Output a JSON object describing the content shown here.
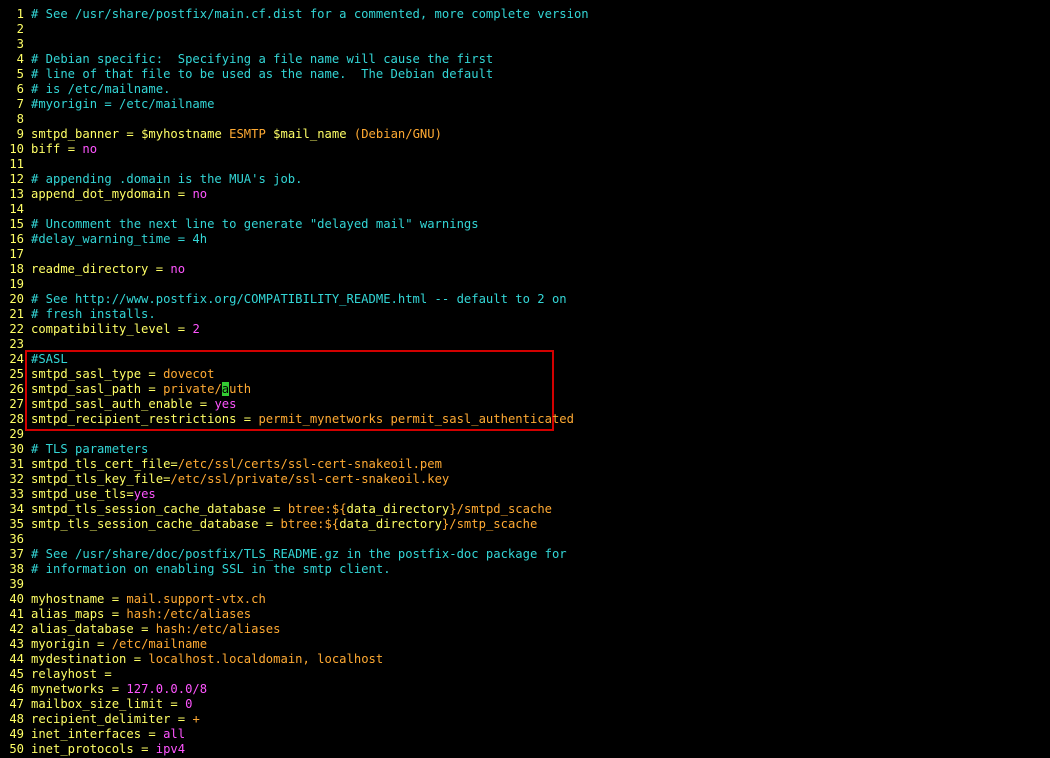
{
  "lines": [
    {
      "n": "1",
      "tokens": [
        {
          "t": "# See /usr/share/postfix/main.cf.dist for a commented, more complete version",
          "c": "comment"
        }
      ]
    },
    {
      "n": "2",
      "tokens": []
    },
    {
      "n": "3",
      "tokens": []
    },
    {
      "n": "4",
      "tokens": [
        {
          "t": "# Debian specific:  Specifying a file name will cause the first",
          "c": "comment"
        }
      ]
    },
    {
      "n": "5",
      "tokens": [
        {
          "t": "# line of that file to be used as the name.  The Debian default",
          "c": "comment"
        }
      ]
    },
    {
      "n": "6",
      "tokens": [
        {
          "t": "# is /etc/mailname.",
          "c": "comment"
        }
      ]
    },
    {
      "n": "7",
      "tokens": [
        {
          "t": "#myorigin = /etc/mailname",
          "c": "comment"
        }
      ]
    },
    {
      "n": "8",
      "tokens": []
    },
    {
      "n": "9",
      "tokens": [
        {
          "t": "smtpd_banner",
          "c": "key"
        },
        {
          "t": " = ",
          "c": "op"
        },
        {
          "t": "$myhostname",
          "c": "var"
        },
        {
          "t": " ESMTP ",
          "c": "val"
        },
        {
          "t": "$mail_name",
          "c": "var"
        },
        {
          "t": " (Debian/GNU)",
          "c": "val"
        }
      ]
    },
    {
      "n": "10",
      "tokens": [
        {
          "t": "biff",
          "c": "key"
        },
        {
          "t": " = ",
          "c": "op"
        },
        {
          "t": "no",
          "c": "const"
        }
      ]
    },
    {
      "n": "11",
      "tokens": []
    },
    {
      "n": "12",
      "tokens": [
        {
          "t": "# appending .domain is the MUA's job.",
          "c": "comment"
        }
      ]
    },
    {
      "n": "13",
      "tokens": [
        {
          "t": "append_dot_mydomain",
          "c": "key"
        },
        {
          "t": " = ",
          "c": "op"
        },
        {
          "t": "no",
          "c": "const"
        }
      ]
    },
    {
      "n": "14",
      "tokens": []
    },
    {
      "n": "15",
      "tokens": [
        {
          "t": "# Uncomment the next line to generate \"delayed mail\" warnings",
          "c": "comment"
        }
      ]
    },
    {
      "n": "16",
      "tokens": [
        {
          "t": "#delay_warning_time = 4h",
          "c": "comment"
        }
      ]
    },
    {
      "n": "17",
      "tokens": []
    },
    {
      "n": "18",
      "tokens": [
        {
          "t": "readme_directory",
          "c": "key"
        },
        {
          "t": " = ",
          "c": "op"
        },
        {
          "t": "no",
          "c": "const"
        }
      ]
    },
    {
      "n": "19",
      "tokens": []
    },
    {
      "n": "20",
      "tokens": [
        {
          "t": "# See http://www.postfix.org/COMPATIBILITY_README.html -- default to 2 on",
          "c": "comment"
        }
      ]
    },
    {
      "n": "21",
      "tokens": [
        {
          "t": "# fresh installs.",
          "c": "comment"
        }
      ]
    },
    {
      "n": "22",
      "tokens": [
        {
          "t": "compatibility_level",
          "c": "key"
        },
        {
          "t": " = ",
          "c": "op"
        },
        {
          "t": "2",
          "c": "const"
        }
      ]
    },
    {
      "n": "23",
      "tokens": []
    },
    {
      "n": "24",
      "tokens": [
        {
          "t": "#SASL",
          "c": "comment"
        }
      ]
    },
    {
      "n": "25",
      "tokens": [
        {
          "t": "smtpd_sasl_type",
          "c": "key"
        },
        {
          "t": " = ",
          "c": "op"
        },
        {
          "t": "dovecot",
          "c": "val"
        }
      ]
    },
    {
      "n": "26",
      "tokens": [
        {
          "t": "smtpd_sasl_path",
          "c": "key"
        },
        {
          "t": " = ",
          "c": "op"
        },
        {
          "t": "private/",
          "c": "val"
        },
        {
          "t": "a",
          "c": "cursor"
        },
        {
          "t": "uth",
          "c": "val"
        }
      ]
    },
    {
      "n": "27",
      "tokens": [
        {
          "t": "smtpd_sasl_auth_enable",
          "c": "key"
        },
        {
          "t": " = ",
          "c": "op"
        },
        {
          "t": "yes",
          "c": "const"
        }
      ]
    },
    {
      "n": "28",
      "tokens": [
        {
          "t": "smtpd_recipient_restrictions",
          "c": "key"
        },
        {
          "t": " = ",
          "c": "op"
        },
        {
          "t": "permit_mynetworks permit_sasl_authenticated",
          "c": "val"
        }
      ]
    },
    {
      "n": "29",
      "tokens": []
    },
    {
      "n": "30",
      "tokens": [
        {
          "t": "# TLS parameters",
          "c": "comment"
        }
      ]
    },
    {
      "n": "31",
      "tokens": [
        {
          "t": "smtpd_tls_cert_file",
          "c": "key"
        },
        {
          "t": "=",
          "c": "op"
        },
        {
          "t": "/etc/ssl/certs/ssl-cert-snakeoil.pem",
          "c": "val"
        }
      ]
    },
    {
      "n": "32",
      "tokens": [
        {
          "t": "smtpd_tls_key_file",
          "c": "key"
        },
        {
          "t": "=",
          "c": "op"
        },
        {
          "t": "/etc/ssl/private/ssl-cert-snakeoil.key",
          "c": "val"
        }
      ]
    },
    {
      "n": "33",
      "tokens": [
        {
          "t": "smtpd_use_tls",
          "c": "key"
        },
        {
          "t": "=",
          "c": "op"
        },
        {
          "t": "yes",
          "c": "const"
        }
      ]
    },
    {
      "n": "34",
      "tokens": [
        {
          "t": "smtpd_tls_session_cache_database",
          "c": "key"
        },
        {
          "t": " = ",
          "c": "op"
        },
        {
          "t": "btree:${",
          "c": "val"
        },
        {
          "t": "data_directory",
          "c": "var"
        },
        {
          "t": "}/smtpd_scache",
          "c": "val"
        }
      ]
    },
    {
      "n": "35",
      "tokens": [
        {
          "t": "smtp_tls_session_cache_database",
          "c": "key"
        },
        {
          "t": " = ",
          "c": "op"
        },
        {
          "t": "btree:${",
          "c": "val"
        },
        {
          "t": "data_directory",
          "c": "var"
        },
        {
          "t": "}/smtp_scache",
          "c": "val"
        }
      ]
    },
    {
      "n": "36",
      "tokens": []
    },
    {
      "n": "37",
      "tokens": [
        {
          "t": "# See /usr/share/doc/postfix/TLS_README.gz in the postfix-doc package for",
          "c": "comment"
        }
      ]
    },
    {
      "n": "38",
      "tokens": [
        {
          "t": "# information on enabling SSL in the smtp client.",
          "c": "comment"
        }
      ]
    },
    {
      "n": "39",
      "tokens": []
    },
    {
      "n": "40",
      "tokens": [
        {
          "t": "myhostname",
          "c": "key"
        },
        {
          "t": " = ",
          "c": "op"
        },
        {
          "t": "mail.support-vtx.ch",
          "c": "val"
        }
      ]
    },
    {
      "n": "41",
      "tokens": [
        {
          "t": "alias_maps",
          "c": "key"
        },
        {
          "t": " = ",
          "c": "op"
        },
        {
          "t": "hash:/etc/aliases",
          "c": "val"
        }
      ]
    },
    {
      "n": "42",
      "tokens": [
        {
          "t": "alias_database",
          "c": "key"
        },
        {
          "t": " = ",
          "c": "op"
        },
        {
          "t": "hash:/etc/aliases",
          "c": "val"
        }
      ]
    },
    {
      "n": "43",
      "tokens": [
        {
          "t": "myorigin",
          "c": "key"
        },
        {
          "t": " = ",
          "c": "op"
        },
        {
          "t": "/etc/mailname",
          "c": "val"
        }
      ]
    },
    {
      "n": "44",
      "tokens": [
        {
          "t": "mydestination",
          "c": "key"
        },
        {
          "t": " = ",
          "c": "op"
        },
        {
          "t": "localhost.localdomain, localhost",
          "c": "val"
        }
      ]
    },
    {
      "n": "45",
      "tokens": [
        {
          "t": "relayhost",
          "c": "key"
        },
        {
          "t": " =",
          "c": "op"
        }
      ]
    },
    {
      "n": "46",
      "tokens": [
        {
          "t": "mynetworks",
          "c": "key"
        },
        {
          "t": " = ",
          "c": "op"
        },
        {
          "t": "127.0.0.0/8",
          "c": "const"
        }
      ]
    },
    {
      "n": "47",
      "tokens": [
        {
          "t": "mailbox_size_limit",
          "c": "key"
        },
        {
          "t": " = ",
          "c": "op"
        },
        {
          "t": "0",
          "c": "const"
        }
      ]
    },
    {
      "n": "48",
      "tokens": [
        {
          "t": "recipient_delimiter",
          "c": "key"
        },
        {
          "t": " = ",
          "c": "op"
        },
        {
          "t": "+",
          "c": "val"
        }
      ]
    },
    {
      "n": "49",
      "tokens": [
        {
          "t": "inet_interfaces",
          "c": "key"
        },
        {
          "t": " = ",
          "c": "op"
        },
        {
          "t": "all",
          "c": "const"
        }
      ]
    },
    {
      "n": "50",
      "tokens": [
        {
          "t": "inet_protocols",
          "c": "key"
        },
        {
          "t": " = ",
          "c": "op"
        },
        {
          "t": "ipv4",
          "c": "const"
        }
      ]
    }
  ],
  "highlight": {
    "from_line": 24,
    "to_line": 28,
    "color": "#d20000"
  },
  "cursor": {
    "line": 26
  },
  "colors": {
    "background": "#000000",
    "line_number": "#ffff66",
    "comment": "#33d6d6",
    "key": "#ffff66",
    "value": "#ffaa33",
    "constant": "#ff55ff",
    "cursor": "#33cc33"
  }
}
